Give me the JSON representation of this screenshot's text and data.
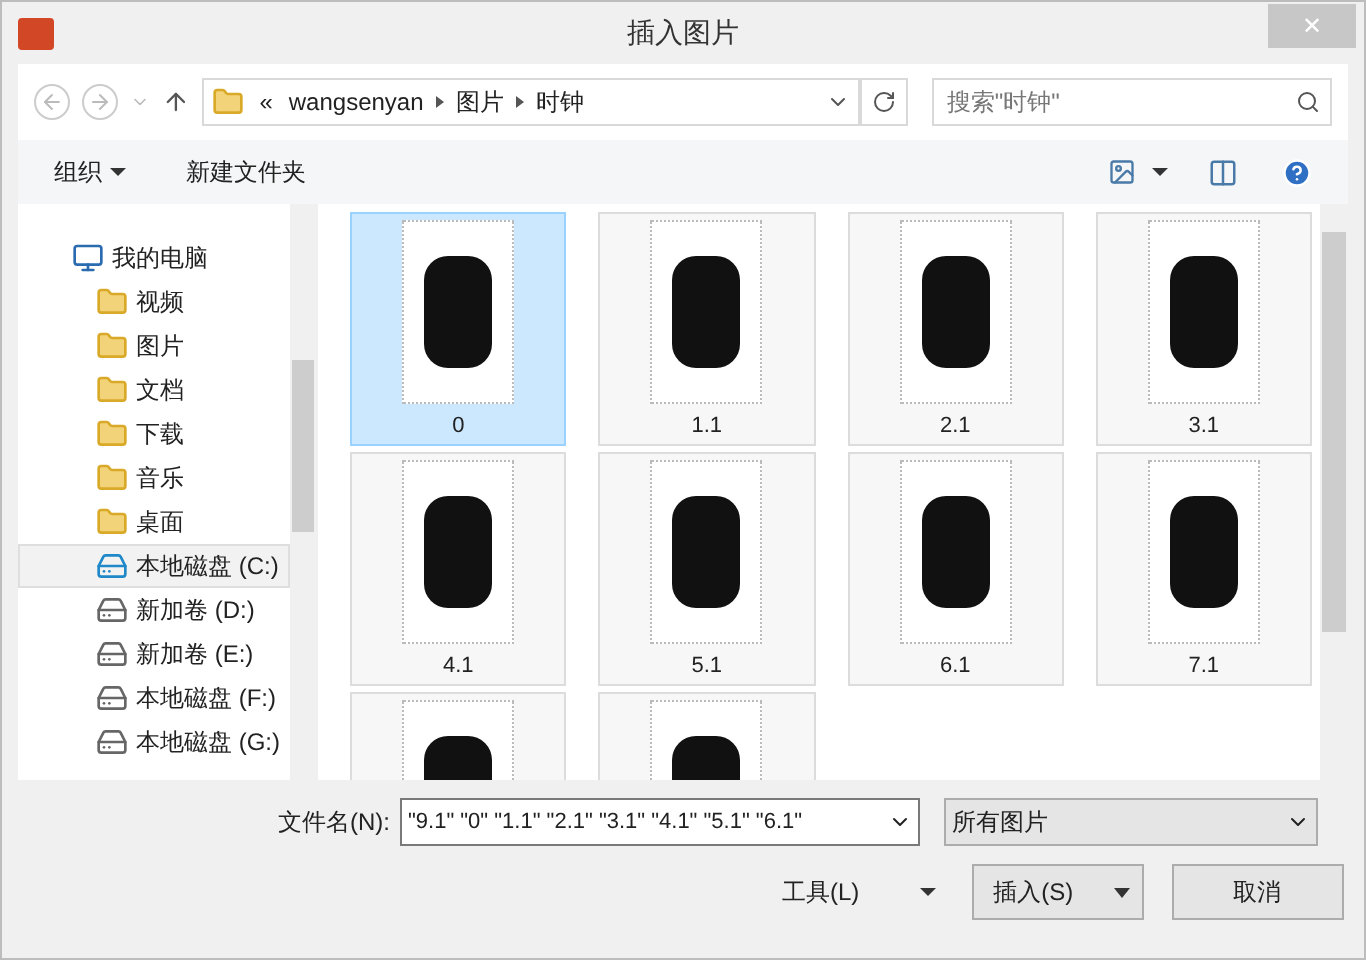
{
  "window": {
    "title": "插入图片",
    "close": "✕"
  },
  "address": {
    "overflow": "«",
    "crumbs": [
      "wangsenyan",
      "图片",
      "时钟"
    ]
  },
  "search": {
    "placeholder": "搜索\"时钟\""
  },
  "toolbar": {
    "organize": "组织",
    "new_folder": "新建文件夹"
  },
  "sidebar": {
    "items": [
      {
        "label": "我的电脑",
        "kind": "computer",
        "selected": false,
        "children": [
          {
            "label": "视频",
            "kind": "folder",
            "selected": false
          },
          {
            "label": "图片",
            "kind": "folder",
            "selected": false
          },
          {
            "label": "文档",
            "kind": "folder",
            "selected": false
          },
          {
            "label": "下载",
            "kind": "folder",
            "selected": false
          },
          {
            "label": "音乐",
            "kind": "folder",
            "selected": false
          },
          {
            "label": "桌面",
            "kind": "folder",
            "selected": false
          },
          {
            "label": "本地磁盘 (C:)",
            "kind": "system-drive",
            "selected": true
          },
          {
            "label": "新加卷 (D:)",
            "kind": "drive",
            "selected": false
          },
          {
            "label": "新加卷 (E:)",
            "kind": "drive",
            "selected": false
          },
          {
            "label": "本地磁盘 (F:)",
            "kind": "drive",
            "selected": false
          },
          {
            "label": "本地磁盘 (G:)",
            "kind": "drive",
            "selected": false
          }
        ]
      }
    ]
  },
  "files": [
    {
      "label": "0",
      "selected": true
    },
    {
      "label": "1.1",
      "selected": false
    },
    {
      "label": "2.1",
      "selected": false
    },
    {
      "label": "3.1",
      "selected": false
    },
    {
      "label": "4.1",
      "selected": false
    },
    {
      "label": "5.1",
      "selected": false
    },
    {
      "label": "6.1",
      "selected": false
    },
    {
      "label": "7.1",
      "selected": false
    },
    {
      "selected": false
    },
    {
      "selected": false
    }
  ],
  "footer": {
    "filename_label": "文件名(N):",
    "filename": "\"9.1\" \"0\" \"1.1\" \"2.1\" \"3.1\" \"4.1\" \"5.1\" \"6.1\"",
    "filter": "所有图片",
    "tools": "工具(L)",
    "insert": "插入(S)",
    "cancel": "取消"
  }
}
